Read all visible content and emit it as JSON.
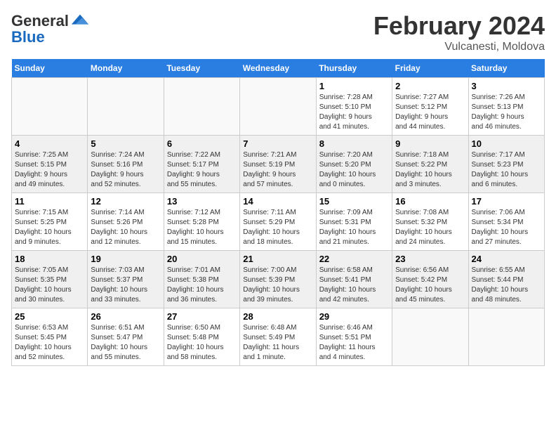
{
  "header": {
    "logo_general": "General",
    "logo_blue": "Blue",
    "month_year": "February 2024",
    "location": "Vulcanesti, Moldova"
  },
  "weekdays": [
    "Sunday",
    "Monday",
    "Tuesday",
    "Wednesday",
    "Thursday",
    "Friday",
    "Saturday"
  ],
  "weeks": [
    [
      {
        "day": "",
        "info": ""
      },
      {
        "day": "",
        "info": ""
      },
      {
        "day": "",
        "info": ""
      },
      {
        "day": "",
        "info": ""
      },
      {
        "day": "1",
        "info": "Sunrise: 7:28 AM\nSunset: 5:10 PM\nDaylight: 9 hours\nand 41 minutes."
      },
      {
        "day": "2",
        "info": "Sunrise: 7:27 AM\nSunset: 5:12 PM\nDaylight: 9 hours\nand 44 minutes."
      },
      {
        "day": "3",
        "info": "Sunrise: 7:26 AM\nSunset: 5:13 PM\nDaylight: 9 hours\nand 46 minutes."
      }
    ],
    [
      {
        "day": "4",
        "info": "Sunrise: 7:25 AM\nSunset: 5:15 PM\nDaylight: 9 hours\nand 49 minutes."
      },
      {
        "day": "5",
        "info": "Sunrise: 7:24 AM\nSunset: 5:16 PM\nDaylight: 9 hours\nand 52 minutes."
      },
      {
        "day": "6",
        "info": "Sunrise: 7:22 AM\nSunset: 5:17 PM\nDaylight: 9 hours\nand 55 minutes."
      },
      {
        "day": "7",
        "info": "Sunrise: 7:21 AM\nSunset: 5:19 PM\nDaylight: 9 hours\nand 57 minutes."
      },
      {
        "day": "8",
        "info": "Sunrise: 7:20 AM\nSunset: 5:20 PM\nDaylight: 10 hours\nand 0 minutes."
      },
      {
        "day": "9",
        "info": "Sunrise: 7:18 AM\nSunset: 5:22 PM\nDaylight: 10 hours\nand 3 minutes."
      },
      {
        "day": "10",
        "info": "Sunrise: 7:17 AM\nSunset: 5:23 PM\nDaylight: 10 hours\nand 6 minutes."
      }
    ],
    [
      {
        "day": "11",
        "info": "Sunrise: 7:15 AM\nSunset: 5:25 PM\nDaylight: 10 hours\nand 9 minutes."
      },
      {
        "day": "12",
        "info": "Sunrise: 7:14 AM\nSunset: 5:26 PM\nDaylight: 10 hours\nand 12 minutes."
      },
      {
        "day": "13",
        "info": "Sunrise: 7:12 AM\nSunset: 5:28 PM\nDaylight: 10 hours\nand 15 minutes."
      },
      {
        "day": "14",
        "info": "Sunrise: 7:11 AM\nSunset: 5:29 PM\nDaylight: 10 hours\nand 18 minutes."
      },
      {
        "day": "15",
        "info": "Sunrise: 7:09 AM\nSunset: 5:31 PM\nDaylight: 10 hours\nand 21 minutes."
      },
      {
        "day": "16",
        "info": "Sunrise: 7:08 AM\nSunset: 5:32 PM\nDaylight: 10 hours\nand 24 minutes."
      },
      {
        "day": "17",
        "info": "Sunrise: 7:06 AM\nSunset: 5:34 PM\nDaylight: 10 hours\nand 27 minutes."
      }
    ],
    [
      {
        "day": "18",
        "info": "Sunrise: 7:05 AM\nSunset: 5:35 PM\nDaylight: 10 hours\nand 30 minutes."
      },
      {
        "day": "19",
        "info": "Sunrise: 7:03 AM\nSunset: 5:37 PM\nDaylight: 10 hours\nand 33 minutes."
      },
      {
        "day": "20",
        "info": "Sunrise: 7:01 AM\nSunset: 5:38 PM\nDaylight: 10 hours\nand 36 minutes."
      },
      {
        "day": "21",
        "info": "Sunrise: 7:00 AM\nSunset: 5:39 PM\nDaylight: 10 hours\nand 39 minutes."
      },
      {
        "day": "22",
        "info": "Sunrise: 6:58 AM\nSunset: 5:41 PM\nDaylight: 10 hours\nand 42 minutes."
      },
      {
        "day": "23",
        "info": "Sunrise: 6:56 AM\nSunset: 5:42 PM\nDaylight: 10 hours\nand 45 minutes."
      },
      {
        "day": "24",
        "info": "Sunrise: 6:55 AM\nSunset: 5:44 PM\nDaylight: 10 hours\nand 48 minutes."
      }
    ],
    [
      {
        "day": "25",
        "info": "Sunrise: 6:53 AM\nSunset: 5:45 PM\nDaylight: 10 hours\nand 52 minutes."
      },
      {
        "day": "26",
        "info": "Sunrise: 6:51 AM\nSunset: 5:47 PM\nDaylight: 10 hours\nand 55 minutes."
      },
      {
        "day": "27",
        "info": "Sunrise: 6:50 AM\nSunset: 5:48 PM\nDaylight: 10 hours\nand 58 minutes."
      },
      {
        "day": "28",
        "info": "Sunrise: 6:48 AM\nSunset: 5:49 PM\nDaylight: 11 hours\nand 1 minute."
      },
      {
        "day": "29",
        "info": "Sunrise: 6:46 AM\nSunset: 5:51 PM\nDaylight: 11 hours\nand 4 minutes."
      },
      {
        "day": "",
        "info": ""
      },
      {
        "day": "",
        "info": ""
      }
    ]
  ]
}
